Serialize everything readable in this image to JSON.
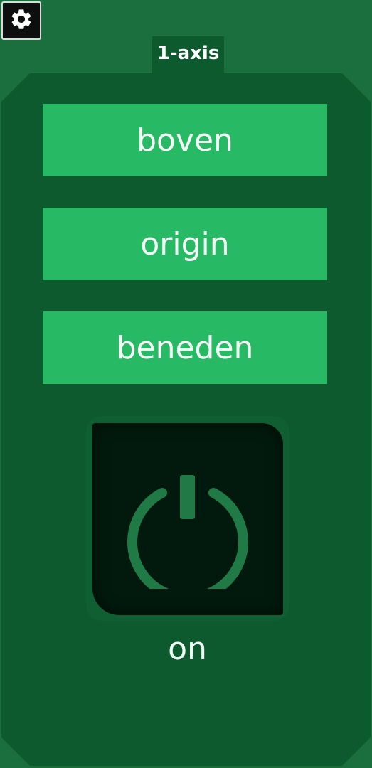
{
  "header": {
    "settings_icon": "gear-icon",
    "title": "1-axis"
  },
  "controls": {
    "buttons": [
      {
        "label": "boven"
      },
      {
        "label": "origin"
      },
      {
        "label": "beneden"
      }
    ],
    "power": {
      "icon": "power-icon",
      "state_label": "on"
    }
  },
  "colors": {
    "background": "#1b6e3e",
    "panel": "#0e5a2f",
    "button": "#27b963",
    "power_button": "#021a0d",
    "power_icon": "#1f7a45"
  }
}
